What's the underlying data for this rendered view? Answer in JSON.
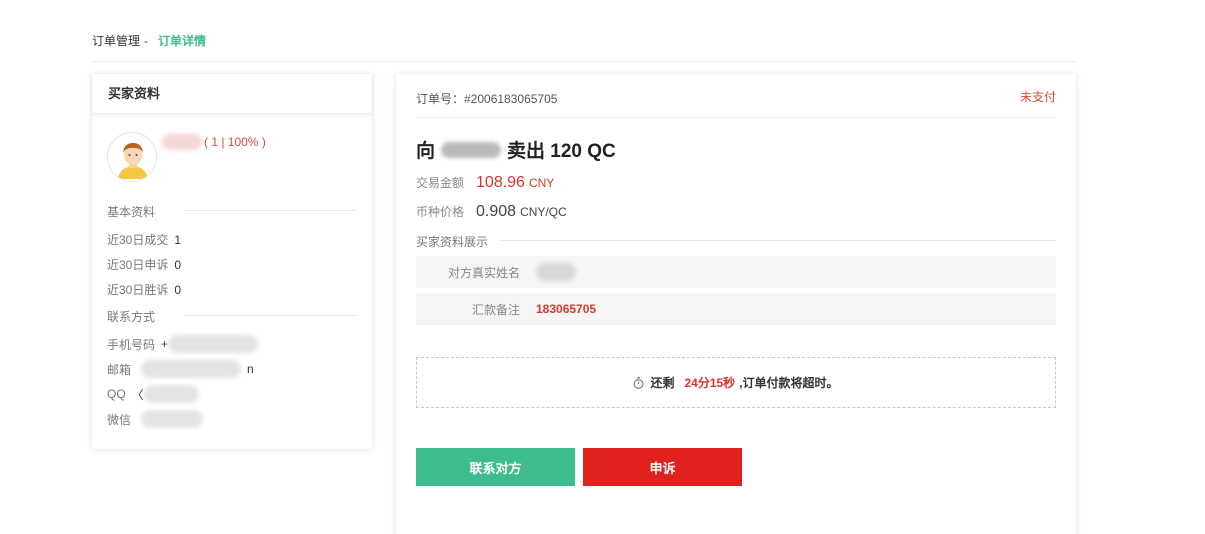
{
  "breadcrumb": {
    "parent": "订单管理",
    "separator": "-",
    "current": "订单详情"
  },
  "buyer_card": {
    "title": "买家资料",
    "stats": "( 1 | 100% )",
    "basic_section": "基本资料",
    "rows": [
      {
        "label": "近30日成交",
        "value": "1"
      },
      {
        "label": "近30日申诉",
        "value": "0"
      },
      {
        "label": "近30日胜诉",
        "value": "0"
      }
    ],
    "contact_section": "联系方式",
    "contacts": [
      {
        "label": "手机号码",
        "value": "+"
      },
      {
        "label": "邮箱",
        "value": "n"
      },
      {
        "label": "QQ",
        "value": "〈"
      },
      {
        "label": "微信",
        "value": ""
      }
    ]
  },
  "order": {
    "order_no": "订单号：#2006183065705",
    "status": "未支付",
    "title_prefix": "向",
    "title_suffix": "卖出 120 QC",
    "amount_label": "交易金额",
    "amount": "108.96",
    "amount_unit": "CNY",
    "price_label": "币种价格",
    "price": "0.908",
    "price_unit": "CNY/QC",
    "display_section": "买家资料展示",
    "real_name_label": "对方真实姓名",
    "remark_label": "汇款备注",
    "remark_value": "183065705",
    "countdown_prefix": "还剩",
    "countdown_time": "24分15秒",
    "countdown_suffix": ",订单付款将超时。",
    "contact_button": "联系对方",
    "appeal_button": "申诉"
  },
  "colors": {
    "accent_green": "#3dbd8c",
    "danger_red": "#e0211e",
    "status_red": "#e0483b"
  },
  "icons": {
    "timer": "stopwatch-icon",
    "avatar": "user-avatar-icon"
  }
}
